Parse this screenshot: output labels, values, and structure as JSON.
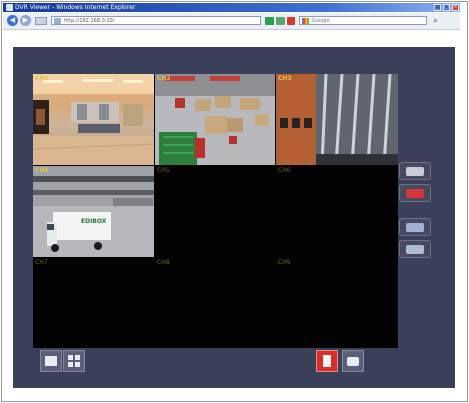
{
  "window": {
    "title": "DVR Viewer - Windows Internet Explorer"
  },
  "browser": {
    "address": "http://192.168.0.10/",
    "search_placeholder": "Google",
    "back_icon": "back-arrow-icon",
    "forward_icon": "forward-arrow-icon"
  },
  "cameras": [
    {
      "label": "CH1"
    },
    {
      "label": "CH2"
    },
    {
      "label": "CH3"
    },
    {
      "label": "CH4"
    },
    {
      "label": "CH5"
    },
    {
      "label": "CH6"
    },
    {
      "label": "CH7"
    },
    {
      "label": "CH8"
    },
    {
      "label": "CH9"
    }
  ],
  "truck_sign": "EDIBOX",
  "colors": {
    "panel": "#3a3f5a",
    "label": "#e0c24a",
    "record": "#d6302a"
  },
  "buttons": {
    "layout_single_icon": "single-view-icon",
    "layout_quad_icon": "quad-view-icon",
    "record_icon": "record-icon",
    "snapshot_icon": "camera-snapshot-icon"
  }
}
